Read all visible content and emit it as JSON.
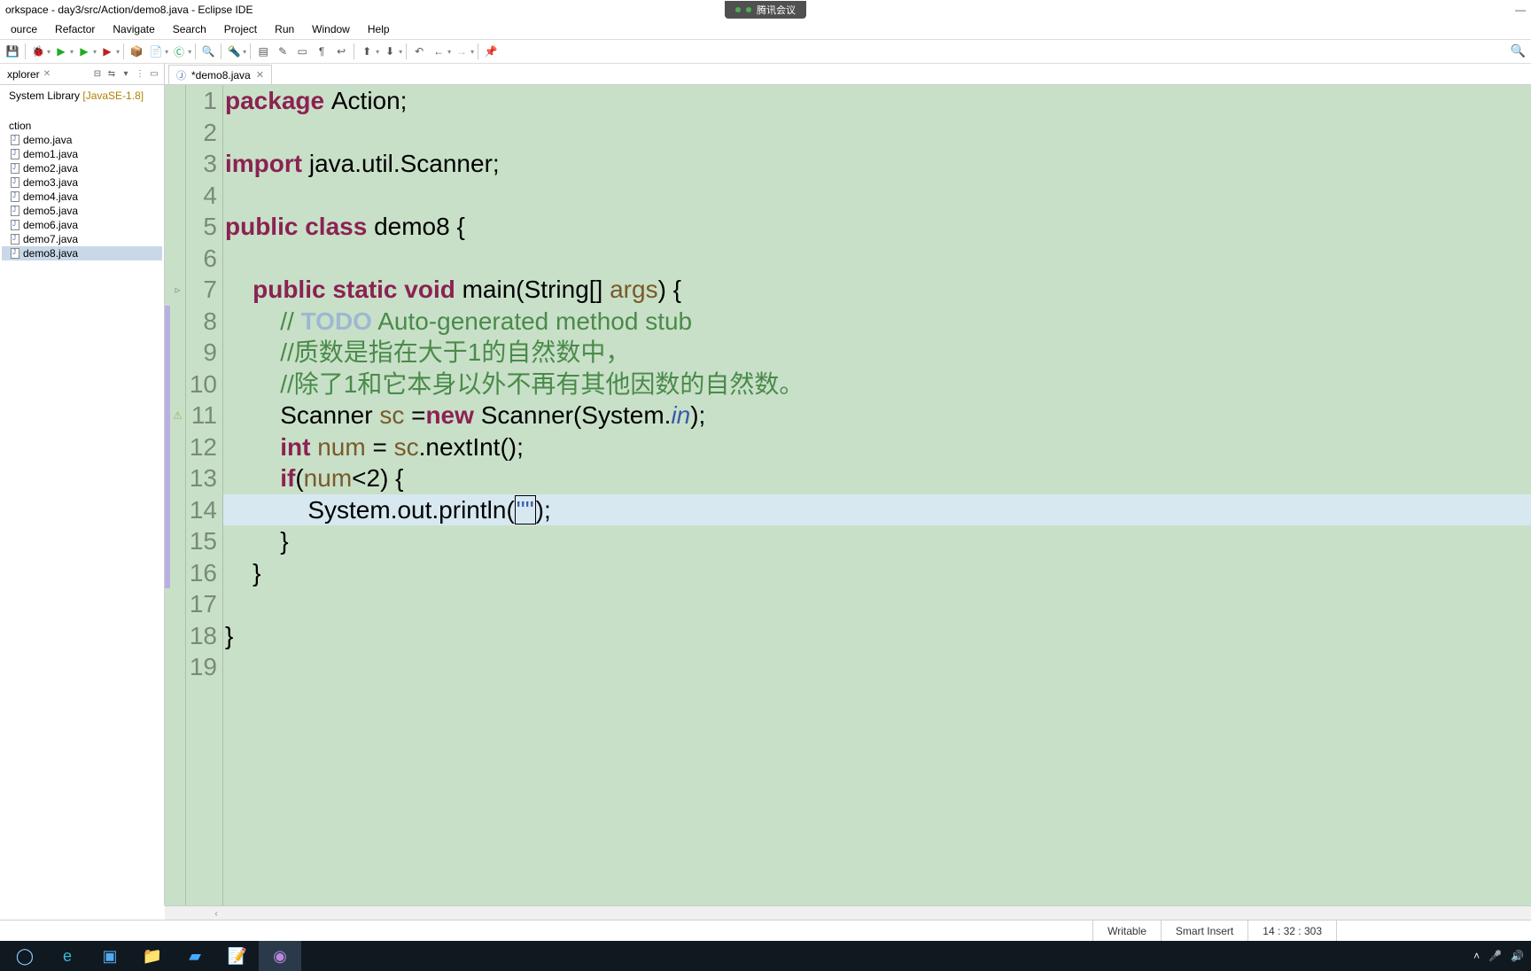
{
  "window": {
    "title": "orkspace - day3/src/Action/demo8.java - Eclipse IDE",
    "meeting_app": "腾讯会议"
  },
  "menu": [
    "ource",
    "Refactor",
    "Navigate",
    "Search",
    "Project",
    "Run",
    "Window",
    "Help"
  ],
  "explorer": {
    "tab": "xplorer",
    "library": "System Library",
    "library_ver": "[JavaSE-1.8]",
    "package": "ction",
    "files": [
      "demo.java",
      "demo1.java",
      "demo2.java",
      "demo3.java",
      "demo4.java",
      "demo5.java",
      "demo6.java",
      "demo7.java",
      "demo8.java"
    ],
    "selected_index": 8
  },
  "editor": {
    "tab": "*demo8.java",
    "lines": [
      {
        "n": 1,
        "tokens": [
          {
            "t": "package ",
            "c": "kw"
          },
          {
            "t": "Action;",
            "c": ""
          }
        ]
      },
      {
        "n": 2,
        "tokens": []
      },
      {
        "n": 3,
        "tokens": [
          {
            "t": "import ",
            "c": "kw"
          },
          {
            "t": "java.util.Scanner;",
            "c": ""
          }
        ]
      },
      {
        "n": 4,
        "tokens": []
      },
      {
        "n": 5,
        "tokens": [
          {
            "t": "public class ",
            "c": "kw"
          },
          {
            "t": "demo8 {",
            "c": ""
          }
        ]
      },
      {
        "n": 6,
        "tokens": []
      },
      {
        "n": 7,
        "tokens": [
          {
            "t": "    ",
            "c": ""
          },
          {
            "t": "public static void ",
            "c": "kw"
          },
          {
            "t": "main(String[] ",
            "c": ""
          },
          {
            "t": "args",
            "c": "var"
          },
          {
            "t": ") {",
            "c": ""
          }
        ],
        "marker": "▹"
      },
      {
        "n": 8,
        "tokens": [
          {
            "t": "        ",
            "c": ""
          },
          {
            "t": "// ",
            "c": "com"
          },
          {
            "t": "TODO",
            "c": "todo"
          },
          {
            "t": " Auto-generated method stub",
            "c": "com"
          }
        ],
        "change": true
      },
      {
        "n": 9,
        "tokens": [
          {
            "t": "        ",
            "c": ""
          },
          {
            "t": "//质数是指在大于1的自然数中，",
            "c": "com"
          }
        ],
        "change": true
      },
      {
        "n": 10,
        "tokens": [
          {
            "t": "        ",
            "c": ""
          },
          {
            "t": "//除了1和它本身以外不再有其他因数的自然数。",
            "c": "com"
          }
        ],
        "change": true
      },
      {
        "n": 11,
        "tokens": [
          {
            "t": "        Scanner ",
            "c": ""
          },
          {
            "t": "sc",
            "c": "var"
          },
          {
            "t": " =",
            "c": ""
          },
          {
            "t": "new ",
            "c": "kw"
          },
          {
            "t": "Scanner(System.",
            "c": ""
          },
          {
            "t": "in",
            "c": "ital"
          },
          {
            "t": ");",
            "c": ""
          }
        ],
        "change": true,
        "marker": "⚠"
      },
      {
        "n": 12,
        "tokens": [
          {
            "t": "        ",
            "c": ""
          },
          {
            "t": "int ",
            "c": "kw"
          },
          {
            "t": "num",
            "c": "var"
          },
          {
            "t": " = ",
            "c": ""
          },
          {
            "t": "sc",
            "c": "var"
          },
          {
            "t": ".nextInt();",
            "c": ""
          }
        ],
        "change": true
      },
      {
        "n": 13,
        "tokens": [
          {
            "t": "        ",
            "c": ""
          },
          {
            "t": "if",
            "c": "kw"
          },
          {
            "t": "(",
            "c": ""
          },
          {
            "t": "num",
            "c": "var"
          },
          {
            "t": "<2) {",
            "c": ""
          }
        ],
        "change": true
      },
      {
        "n": 14,
        "tokens": [
          {
            "t": "            System.out.println(",
            "c": ""
          },
          {
            "t": "\"\"",
            "c": "str",
            "box": true
          },
          {
            "t": ");",
            "c": ""
          }
        ],
        "hl": true,
        "change": true
      },
      {
        "n": 15,
        "tokens": [
          {
            "t": "        }",
            "c": ""
          }
        ],
        "change": true
      },
      {
        "n": 16,
        "tokens": [
          {
            "t": "    }",
            "c": ""
          }
        ],
        "change": true
      },
      {
        "n": 17,
        "tokens": []
      },
      {
        "n": 18,
        "tokens": [
          {
            "t": "}",
            "c": ""
          }
        ]
      },
      {
        "n": 19,
        "tokens": []
      }
    ]
  },
  "status": {
    "writable": "Writable",
    "insert": "Smart Insert",
    "pos": "14 : 32 : 303"
  },
  "tray": {}
}
